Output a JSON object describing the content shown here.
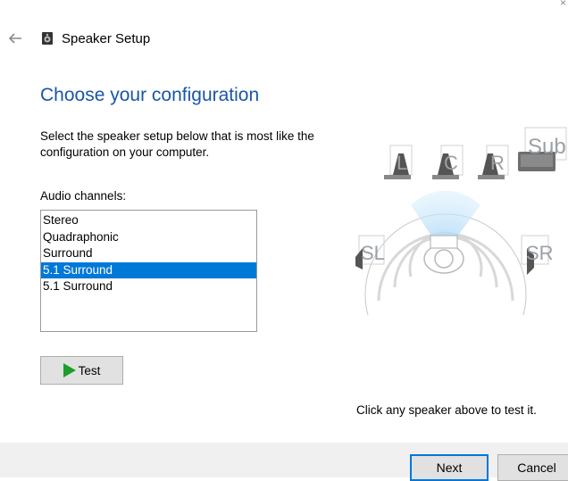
{
  "window": {
    "title": "Speaker Setup",
    "close_glyph": "×"
  },
  "page": {
    "heading": "Choose your configuration",
    "description": "Select the speaker setup below that is most like the configuration on your computer.",
    "audio_channels_label": "Audio channels:",
    "channels": [
      "Stereo",
      "Quadraphonic",
      "Surround",
      "5.1 Surround",
      "5.1 Surround"
    ],
    "selected_index": 3,
    "test_label": "Test",
    "hint": "Click any speaker above to test it."
  },
  "speakers": {
    "left": "L",
    "center": "C",
    "right": "R",
    "sub": "Sub",
    "surround_left": "SL",
    "surround_right": "SR"
  },
  "footer": {
    "next_label": "Next",
    "cancel_label": "Cancel"
  },
  "colors": {
    "accent": "#0078d7",
    "heading": "#1a56a8",
    "play": "#1b9f2a"
  }
}
